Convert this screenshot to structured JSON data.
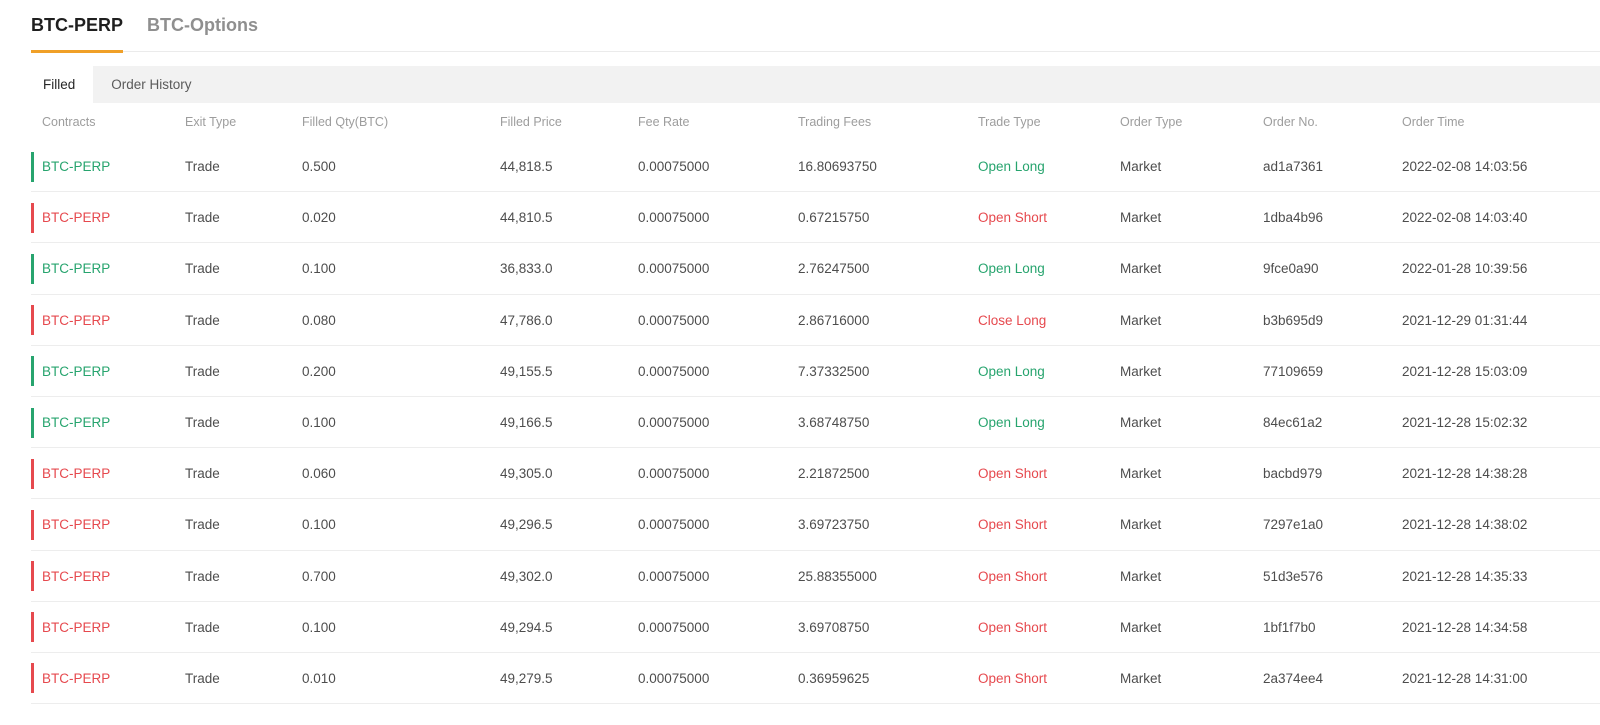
{
  "page": {
    "primary_tabs": [
      {
        "label": "BTC-PERP",
        "active": true
      },
      {
        "label": "BTC-Options",
        "active": false
      }
    ],
    "secondary_tabs": [
      {
        "label": "Filled",
        "active": true
      },
      {
        "label": "Order History",
        "active": false
      }
    ]
  },
  "colors": {
    "accent_orange": "#f0a028",
    "long_green": "#27a46e",
    "short_red": "#e6494e"
  },
  "table": {
    "columns": [
      "Contracts",
      "Exit Type",
      "Filled Qty(BTC)",
      "Filled Price",
      "Fee Rate",
      "Trading Fees",
      "Trade Type",
      "Order Type",
      "Order No.",
      "Order Time"
    ],
    "rows": [
      {
        "side": "buy",
        "contract": "BTC-PERP",
        "exit_type": "Trade",
        "filled_qty": "0.500",
        "filled_price": "44,818.5",
        "fee_rate": "0.00075000",
        "trading_fees": "16.80693750",
        "trade_type": "Open Long",
        "order_type": "Market",
        "order_no": "ad1a7361",
        "order_time": "2022-02-08 14:03:56"
      },
      {
        "side": "sell",
        "contract": "BTC-PERP",
        "exit_type": "Trade",
        "filled_qty": "0.020",
        "filled_price": "44,810.5",
        "fee_rate": "0.00075000",
        "trading_fees": "0.67215750",
        "trade_type": "Open Short",
        "order_type": "Market",
        "order_no": "1dba4b96",
        "order_time": "2022-02-08 14:03:40"
      },
      {
        "side": "buy",
        "contract": "BTC-PERP",
        "exit_type": "Trade",
        "filled_qty": "0.100",
        "filled_price": "36,833.0",
        "fee_rate": "0.00075000",
        "trading_fees": "2.76247500",
        "trade_type": "Open Long",
        "order_type": "Market",
        "order_no": "9fce0a90",
        "order_time": "2022-01-28 10:39:56"
      },
      {
        "side": "sell",
        "contract": "BTC-PERP",
        "exit_type": "Trade",
        "filled_qty": "0.080",
        "filled_price": "47,786.0",
        "fee_rate": "0.00075000",
        "trading_fees": "2.86716000",
        "trade_type": "Close Long",
        "order_type": "Market",
        "order_no": "b3b695d9",
        "order_time": "2021-12-29 01:31:44"
      },
      {
        "side": "buy",
        "contract": "BTC-PERP",
        "exit_type": "Trade",
        "filled_qty": "0.200",
        "filled_price": "49,155.5",
        "fee_rate": "0.00075000",
        "trading_fees": "7.37332500",
        "trade_type": "Open Long",
        "order_type": "Market",
        "order_no": "77109659",
        "order_time": "2021-12-28 15:03:09"
      },
      {
        "side": "buy",
        "contract": "BTC-PERP",
        "exit_type": "Trade",
        "filled_qty": "0.100",
        "filled_price": "49,166.5",
        "fee_rate": "0.00075000",
        "trading_fees": "3.68748750",
        "trade_type": "Open Long",
        "order_type": "Market",
        "order_no": "84ec61a2",
        "order_time": "2021-12-28 15:02:32"
      },
      {
        "side": "sell",
        "contract": "BTC-PERP",
        "exit_type": "Trade",
        "filled_qty": "0.060",
        "filled_price": "49,305.0",
        "fee_rate": "0.00075000",
        "trading_fees": "2.21872500",
        "trade_type": "Open Short",
        "order_type": "Market",
        "order_no": "bacbd979",
        "order_time": "2021-12-28 14:38:28"
      },
      {
        "side": "sell",
        "contract": "BTC-PERP",
        "exit_type": "Trade",
        "filled_qty": "0.100",
        "filled_price": "49,296.5",
        "fee_rate": "0.00075000",
        "trading_fees": "3.69723750",
        "trade_type": "Open Short",
        "order_type": "Market",
        "order_no": "7297e1a0",
        "order_time": "2021-12-28 14:38:02"
      },
      {
        "side": "sell",
        "contract": "BTC-PERP",
        "exit_type": "Trade",
        "filled_qty": "0.700",
        "filled_price": "49,302.0",
        "fee_rate": "0.00075000",
        "trading_fees": "25.88355000",
        "trade_type": "Open Short",
        "order_type": "Market",
        "order_no": "51d3e576",
        "order_time": "2021-12-28 14:35:33"
      },
      {
        "side": "sell",
        "contract": "BTC-PERP",
        "exit_type": "Trade",
        "filled_qty": "0.100",
        "filled_price": "49,294.5",
        "fee_rate": "0.00075000",
        "trading_fees": "3.69708750",
        "trade_type": "Open Short",
        "order_type": "Market",
        "order_no": "1bf1f7b0",
        "order_time": "2021-12-28 14:34:58"
      },
      {
        "side": "sell",
        "contract": "BTC-PERP",
        "exit_type": "Trade",
        "filled_qty": "0.010",
        "filled_price": "49,279.5",
        "fee_rate": "0.00075000",
        "trading_fees": "0.36959625",
        "trade_type": "Open Short",
        "order_type": "Market",
        "order_no": "2a374ee4",
        "order_time": "2021-12-28 14:31:00"
      }
    ]
  }
}
